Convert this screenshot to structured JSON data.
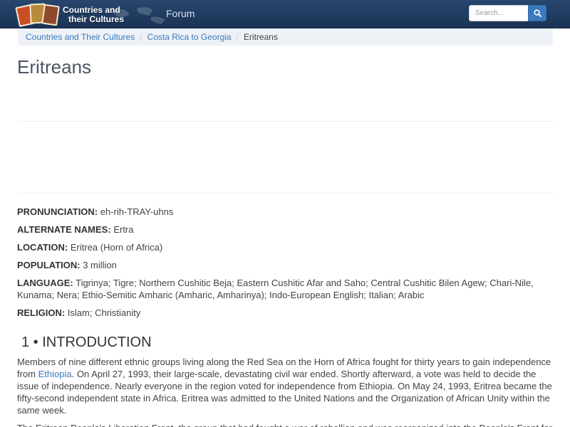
{
  "navbar": {
    "brand_line1": "Countries and",
    "brand_line2": "their Cultures",
    "forum_label": "Forum",
    "search_placeholder": "Search...",
    "search_icon": "magnifier-icon"
  },
  "breadcrumb": {
    "items": [
      "Countries and Their Cultures",
      "Costa Rica to Georgia"
    ],
    "current": "Eritreans"
  },
  "page": {
    "title": "Eritreans"
  },
  "facts": [
    {
      "label": "PRONUNCIATION:",
      "value": "eh-rih-TRAY-uhns"
    },
    {
      "label": "ALTERNATE NAMES:",
      "value": "Ertra"
    },
    {
      "label": "LOCATION:",
      "value": "Eritrea (Horn of Africa)"
    },
    {
      "label": "POPULATION:",
      "value": "3 million"
    },
    {
      "label": "LANGUAGE:",
      "value": "Tigrinya; Tigre; Northern Cushitic Beja; Eastern Cushitic Afar and Saho; Central Cushitic Bilen Agew; Chari-Nile, Kunama; Nera; Ethio-Semitic Amharic (Amharic, Amharinya); Indo-European English; Italian; Arabic"
    },
    {
      "label": "RELIGION:",
      "value": "Islam; Christianity"
    }
  ],
  "section": {
    "heading": "1 • INTRODUCTION",
    "para_before_link": "Members of nine different ethnic groups living along the Red Sea on the Horn of Africa fought for thirty years to gain independence from ",
    "link_text": "Ethiopia",
    "para_after_link": ". On April 27, 1993, their large-scale, devastating civil war ended. Shortly afterward, a vote was held to decide the issue of independence. Nearly everyone in the region voted for independence from Ethiopia. On May 24, 1993, Eritrea became the fifty-second independent state in Africa. Eritrea was admitted to the United Nations and the Organization of African Unity within the same week.",
    "next_para": "The Eritrean People's Liberation Front, the group that had fought a war of rebellion and was reorganized into the People's Front for"
  }
}
